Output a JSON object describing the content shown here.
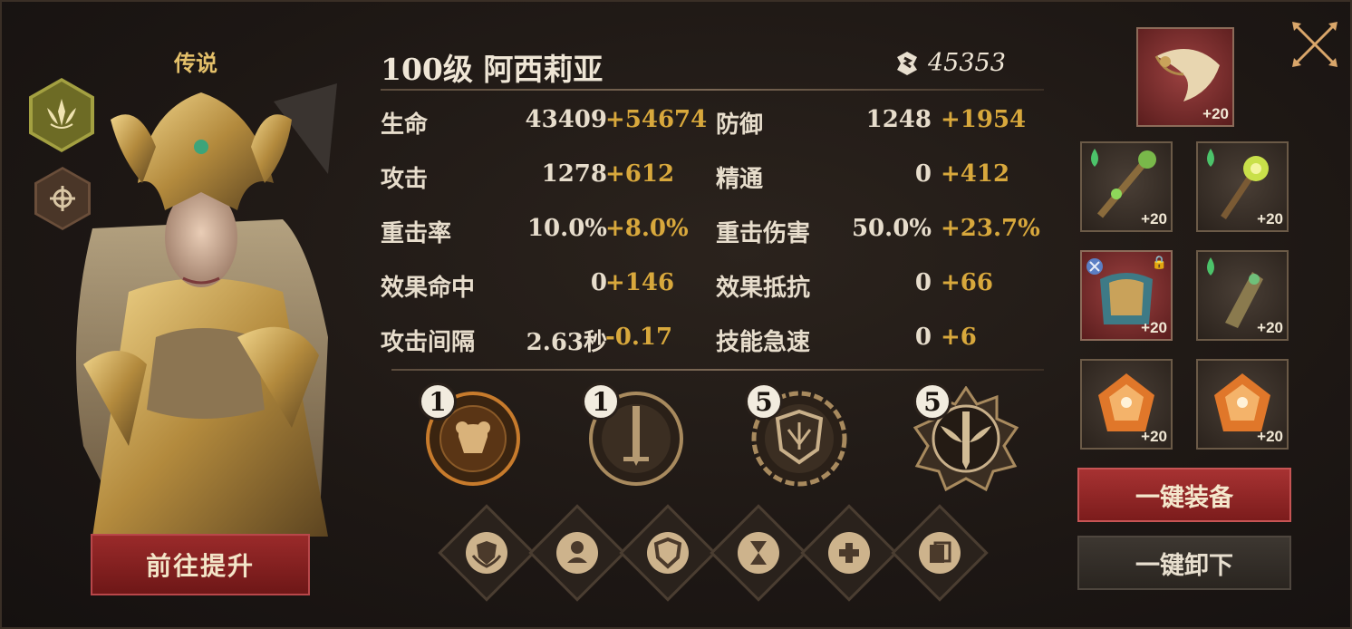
{
  "hero": {
    "rarity": "传说",
    "name": "100级  阿西莉亚",
    "power": "45353",
    "upgrade_label": "前往提升"
  },
  "stats": [
    {
      "label": "生命",
      "base": "43409",
      "bonus": "+54674"
    },
    {
      "label": "防御",
      "base": "1248",
      "bonus": "+1954"
    },
    {
      "label": "攻击",
      "base": "1278",
      "bonus": "+612"
    },
    {
      "label": "精通",
      "base": "0",
      "bonus": "+412"
    },
    {
      "label": "重击率",
      "base": "10.0%",
      "bonus": "+8.0%"
    },
    {
      "label": "重击伤害",
      "base": "50.0%",
      "bonus": "+23.7%"
    },
    {
      "label": "效果命中",
      "base": "0",
      "bonus": "+146"
    },
    {
      "label": "效果抵抗",
      "base": "0",
      "bonus": "+66"
    },
    {
      "label": "攻击间隔",
      "base": "2.63秒",
      "bonus": "-0.17"
    },
    {
      "label": "技能急速",
      "base": "0",
      "bonus": "+6"
    }
  ],
  "medallions": [
    {
      "icon": "armor-medal-icon",
      "level": "1"
    },
    {
      "icon": "sword-medal-icon",
      "level": "1"
    },
    {
      "icon": "shield-crest-medal-icon",
      "level": "5"
    },
    {
      "icon": "winged-sword-medal-icon",
      "level": "5"
    }
  ],
  "skill_diamonds": [
    "shield-hands-icon",
    "shield-bust-icon",
    "shield-icon",
    "hourglass-icon",
    "heal-cross-icon",
    "stack-shield-icon"
  ],
  "equipment": [
    {
      "icon": "horn-icon",
      "plus": "+20"
    },
    {
      "icon": "staff-icon",
      "plus": "+20"
    },
    {
      "icon": "scepter-icon",
      "plus": "+20"
    },
    {
      "icon": "armor-chest-icon",
      "plus": "+20"
    },
    {
      "icon": "gauntlet-icon",
      "plus": "+20"
    },
    {
      "icon": "gem-icon",
      "plus": "+20"
    },
    {
      "icon": "gem-icon",
      "plus": "+20"
    }
  ],
  "buttons": {
    "equip_all": "一键装备",
    "unequip_all": "一键卸下"
  },
  "colors": {
    "accent_gold": "#d8a83c",
    "button_red": "#a73232",
    "text_light": "#e7ddcc"
  }
}
